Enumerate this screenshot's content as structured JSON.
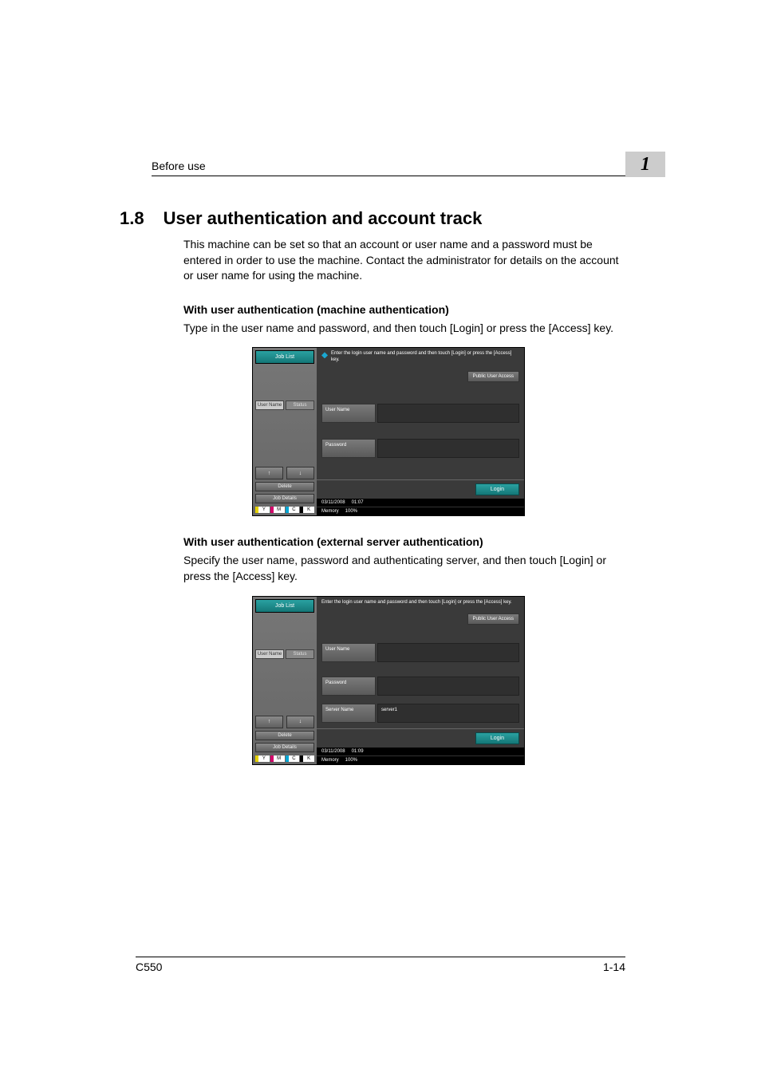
{
  "header": {
    "label": "Before use",
    "chapter_number": "1"
  },
  "section": {
    "number": "1.8",
    "title": "User authentication and account track"
  },
  "intro": "This machine can be set so that an account or user name and a password must be entered in order to use the machine. Contact the administrator for details on the account or user name for using the machine.",
  "proc1": {
    "heading": "With user authentication (machine authentication)",
    "body": "Type in the user name and password, and then touch [Login] or press the [Access] key."
  },
  "proc2": {
    "heading": "With user authentication (external server authentication)",
    "body": "Specify the user name, password and authenticating server, and then touch [Login] or press the [Access] key."
  },
  "shot": {
    "joblist": "Job List",
    "tab_user": "User Name",
    "tab_status": "Status",
    "arrow_up": "↑",
    "arrow_down": "↓",
    "delete": "Delete",
    "jobdetails": "Job Details",
    "toner_y": "Y",
    "toner_m": "M",
    "toner_c": "C",
    "toner_k": "K",
    "msg": "Enter the login user name and password and then touch [Login] or press the [Access] key.",
    "public": "Public User Access",
    "username": "User Name",
    "password": "Password",
    "servername": "Server Name",
    "servervalue": "server1",
    "login": "Login",
    "date1": "03/11/2008",
    "time1": "01:07",
    "date2": "03/11/2008",
    "time2": "01:09",
    "memory": "Memory",
    "memval": "100%"
  },
  "footer": {
    "model": "C550",
    "page": "1-14"
  }
}
